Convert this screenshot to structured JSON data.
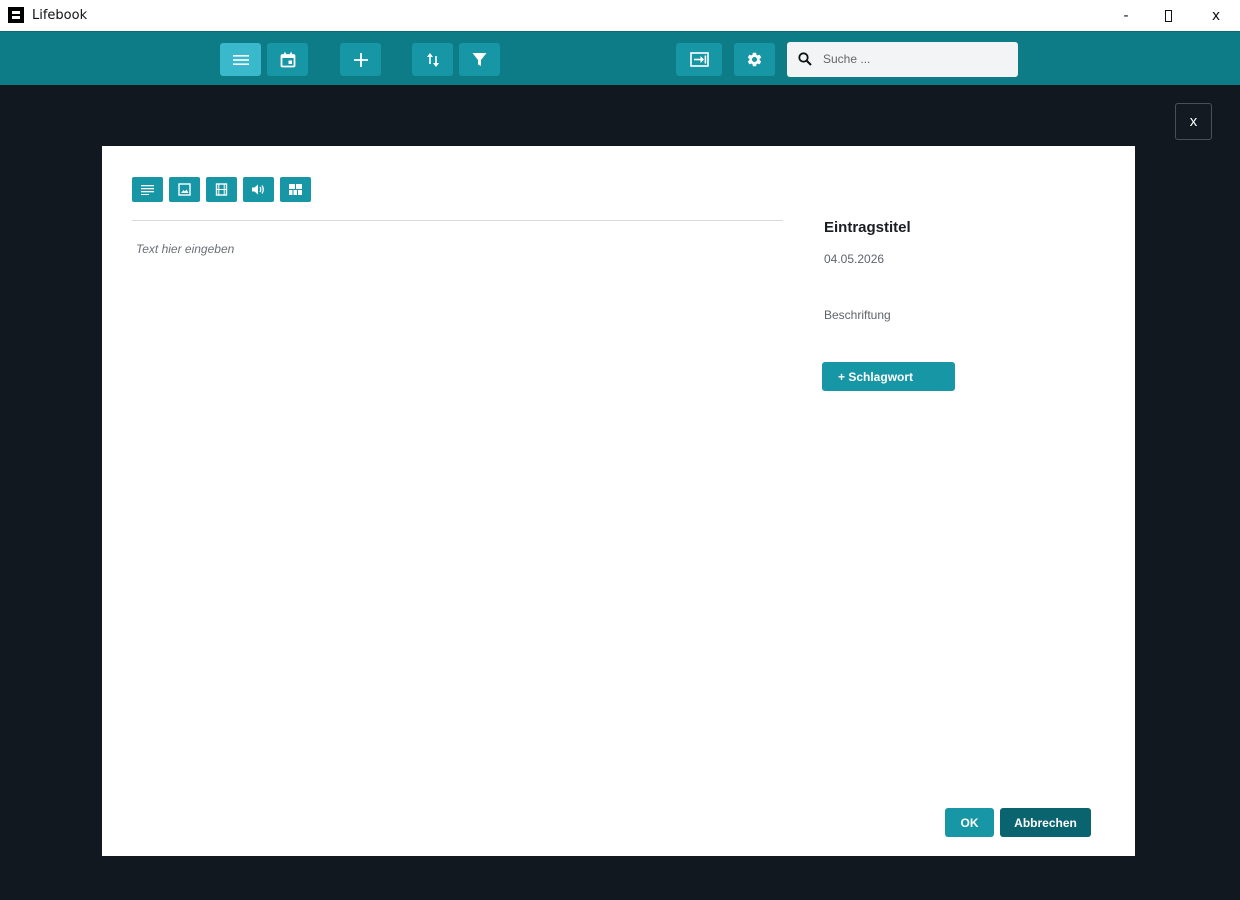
{
  "window": {
    "title": "Lifebook",
    "minimize_label": "-",
    "close_label": "x"
  },
  "toolbar": {
    "buttons": [
      {
        "name": "list-view",
        "icon": "menu-lines-icon",
        "active": true
      },
      {
        "name": "calendar-view",
        "icon": "calendar-icon",
        "active": false
      },
      {
        "name": "add-entry",
        "icon": "plus-icon",
        "active": false
      },
      {
        "name": "sort",
        "icon": "sort-arrows-icon",
        "active": false
      },
      {
        "name": "filter",
        "icon": "filter-funnel-icon",
        "active": false
      },
      {
        "name": "import",
        "icon": "login-arrow-icon",
        "active": false
      },
      {
        "name": "settings",
        "icon": "gear-icon",
        "active": false
      }
    ],
    "search": {
      "placeholder": "Suche ...",
      "value": ""
    }
  },
  "overlay": {
    "close_label": "x"
  },
  "dialog": {
    "editor_tools": [
      {
        "name": "text",
        "icon": "text-lines-icon"
      },
      {
        "name": "image",
        "icon": "image-icon"
      },
      {
        "name": "video",
        "icon": "film-icon"
      },
      {
        "name": "audio",
        "icon": "speaker-icon"
      },
      {
        "name": "gallery",
        "icon": "grid-icon"
      }
    ],
    "text_placeholder": "Text hier eingeben",
    "entry_title": "Eintragstitel",
    "entry_date": "04.05.2026",
    "caption": "Beschriftung",
    "tag_button_label": "+ Schlagwort",
    "ok_label": "OK",
    "cancel_label": "Abbrechen"
  },
  "colors": {
    "toolbar_bg": "#0e7c86",
    "button_bg": "#1796a6",
    "button_active_bg": "#3ab8cc",
    "cancel_bg": "#0a6470",
    "backdrop": "#111820"
  }
}
